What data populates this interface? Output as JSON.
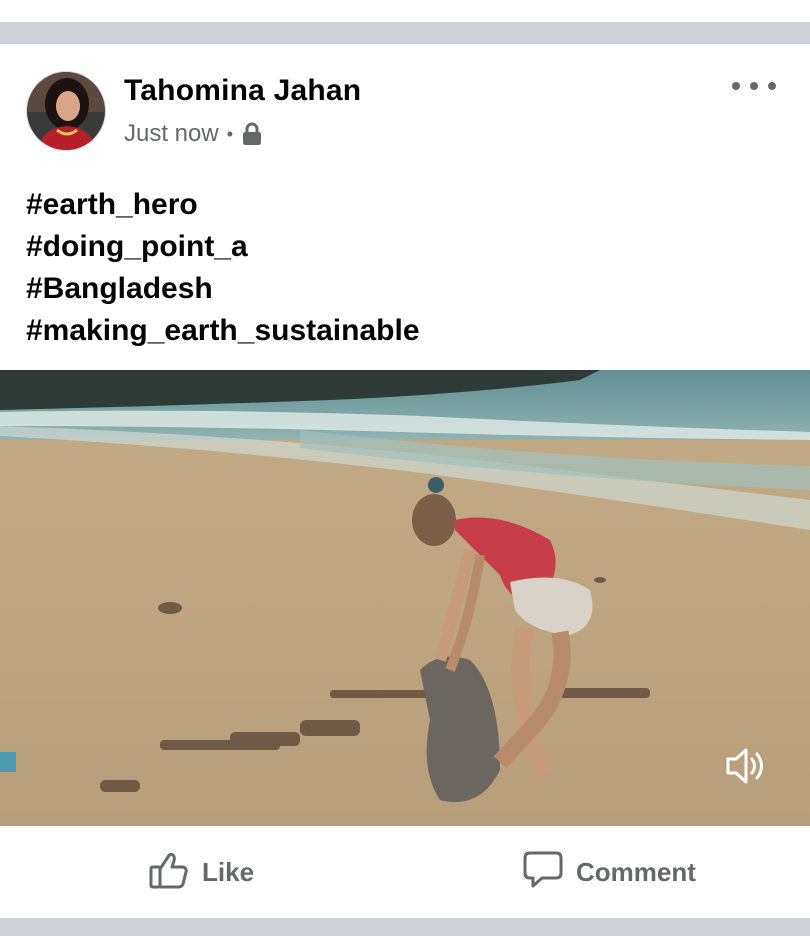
{
  "post": {
    "author": "Tahomina Jahan",
    "time": "Just now",
    "separator": "•",
    "privacy_icon": "lock-icon",
    "menu_icon": "more-icon",
    "caption_lines": [
      "#earth_hero",
      "#doing_point_a",
      "#Bangladesh",
      "#making_earth_sustainable"
    ],
    "media": {
      "type": "video",
      "scene": "beach",
      "sound_icon": "speaker-icon"
    },
    "actions": {
      "like_label": "Like",
      "like_icon": "thumbs-up-icon",
      "comment_label": "Comment",
      "comment_icon": "comment-bubble-icon"
    }
  },
  "colors": {
    "separator": "#cdd0d4",
    "text_primary": "#050505",
    "text_secondary": "#65676b"
  }
}
